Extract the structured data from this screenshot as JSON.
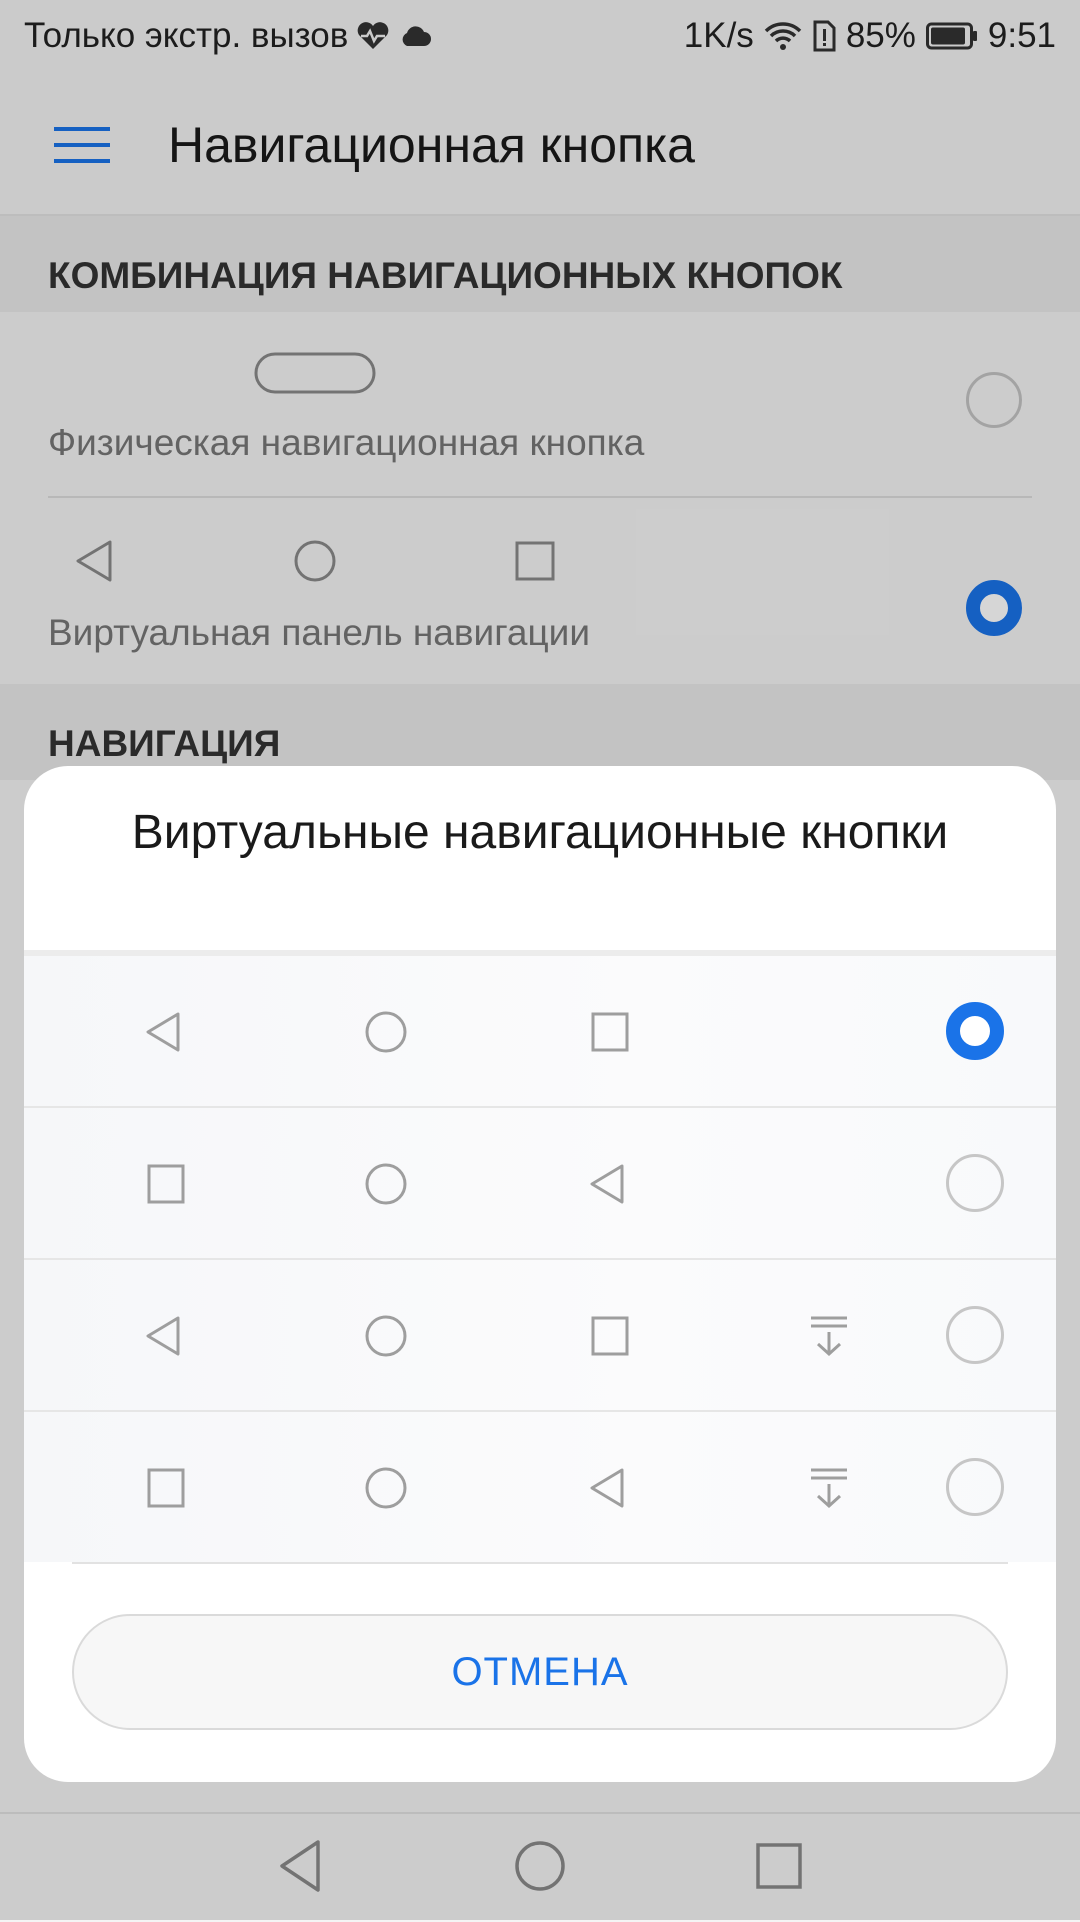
{
  "status_bar": {
    "carrier_text": "Только экстр. вызов",
    "speed": "1K/s",
    "battery": "85%",
    "time": "9:51",
    "icons": [
      "heart-rate-icon",
      "cloud-icon",
      "wifi-icon",
      "sim-alert-icon",
      "battery-icon"
    ]
  },
  "app_bar": {
    "title": "Навигационная кнопка",
    "menu_icon": "hamburger-menu-icon"
  },
  "section_combination": {
    "header": "КОМБИНАЦИЯ НАВИГАЦИОННЫХ КНОПОК",
    "options": [
      {
        "label": "Физическая навигационная кнопка",
        "selected": false
      },
      {
        "label": "Виртуальная панель навигации",
        "selected": true
      }
    ]
  },
  "section_navigation": {
    "header": "НАВИГАЦИЯ"
  },
  "dialog": {
    "title": "Виртуальные навигационные кнопки",
    "options": [
      {
        "icons": [
          "back-icon",
          "home-icon",
          "recents-icon"
        ],
        "selected": true
      },
      {
        "icons": [
          "recents-icon",
          "home-icon",
          "back-icon"
        ],
        "selected": false
      },
      {
        "icons": [
          "back-icon",
          "home-icon",
          "recents-icon",
          "notification-pull-down-icon"
        ],
        "selected": false
      },
      {
        "icons": [
          "recents-icon",
          "home-icon",
          "back-icon",
          "notification-pull-down-icon"
        ],
        "selected": false
      }
    ],
    "cancel_label": "ОТМЕНА"
  },
  "colors": {
    "accent": "#1a73e8",
    "icon_gray": "#9e9e9e"
  }
}
